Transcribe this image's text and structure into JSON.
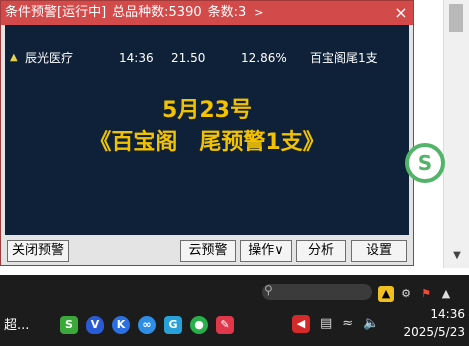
{
  "alert": {
    "title_parts": [
      "条件预警[运行中]",
      "总品种数:5390",
      "条数:3"
    ],
    "title_chevron": ">",
    "close_glyph": "×",
    "row": {
      "name": "辰光医疗",
      "time": "14:36",
      "price": "21.50",
      "change": "12.86%",
      "condition": "百宝阁尾1支"
    },
    "headline": {
      "line1": "5月23号",
      "line2": "《百宝阁　尾预警1支》"
    },
    "buttons": {
      "close_alert": "关闭预警",
      "cloud_alert": "云预警",
      "operate": "操作∨",
      "analyze": "分析",
      "settings": "设置"
    }
  },
  "taskbar": {
    "start_label": "超...",
    "clock_time": "14:36",
    "clock_date": "2025/5/23"
  },
  "colors": {
    "title_bar": "#d24a4a",
    "alert_background": "#0e2139",
    "headline_text": "#f2c200",
    "up_arrow": "#e8d24a"
  }
}
